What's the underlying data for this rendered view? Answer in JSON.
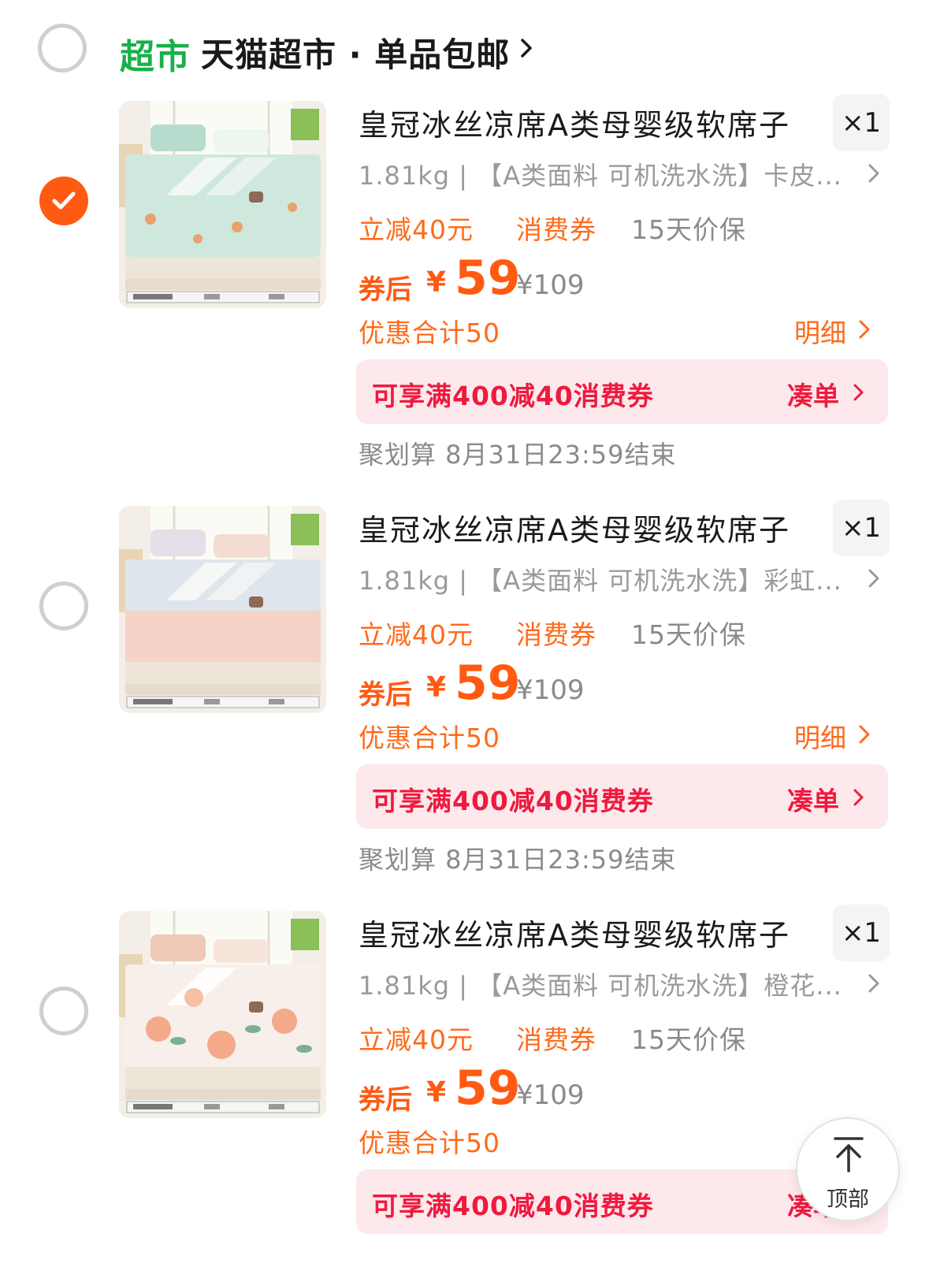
{
  "shop": {
    "tag": "超市",
    "name": "天猫超市 · 单品包邮",
    "selected": false,
    "chevron_icon": "chevron-right-icon"
  },
  "items": [
    {
      "selected": true,
      "title": "皇冠冰丝凉席A类母婴级软席子",
      "quantity": "×1",
      "sku": "1.81kg | 【A类面料 可机洗水洗】卡皮...",
      "tags": [
        "立减40元",
        "消费券",
        "15天价保"
      ],
      "price_label": "券后",
      "currency": "¥",
      "price": "59",
      "original_price": "¥109",
      "discount_total": "优惠合计50",
      "detail_label": "明细",
      "promo_text": "可享满400减40消费券",
      "promo_button": "凑单",
      "juhuasuan": "聚划算 8月31日23:59结束",
      "image_theme": "mint"
    },
    {
      "selected": false,
      "title": "皇冠冰丝凉席A类母婴级软席子",
      "quantity": "×1",
      "sku": "1.81kg | 【A类面料 可机洗水洗】彩虹...",
      "tags": [
        "立减40元",
        "消费券",
        "15天价保"
      ],
      "price_label": "券后",
      "currency": "¥",
      "price": "59",
      "original_price": "¥109",
      "discount_total": "优惠合计50",
      "detail_label": "明细",
      "promo_text": "可享满400减40消费券",
      "promo_button": "凑单",
      "juhuasuan": "聚划算 8月31日23:59结束",
      "image_theme": "rainbow"
    },
    {
      "selected": false,
      "title": "皇冠冰丝凉席A类母婴级软席子",
      "quantity": "×1",
      "sku": "1.81kg | 【A类面料 可机洗水洗】橙花...",
      "tags": [
        "立减40元",
        "消费券",
        "15天价保"
      ],
      "price_label": "券后",
      "currency": "¥",
      "price": "59",
      "original_price": "¥109",
      "discount_total": "优惠合计50",
      "promo_text": "可享满400减40消费券",
      "promo_button": "凑单",
      "image_theme": "orange-flower"
    }
  ],
  "back_to_top": {
    "label": "顶部",
    "icon": "arrow-up-icon"
  },
  "colors": {
    "accent": "#ff5a12",
    "brand_green": "#18b04a",
    "promo_red": "#f0193e",
    "promo_bg": "#fde9ec",
    "muted": "#8a8a8a"
  }
}
